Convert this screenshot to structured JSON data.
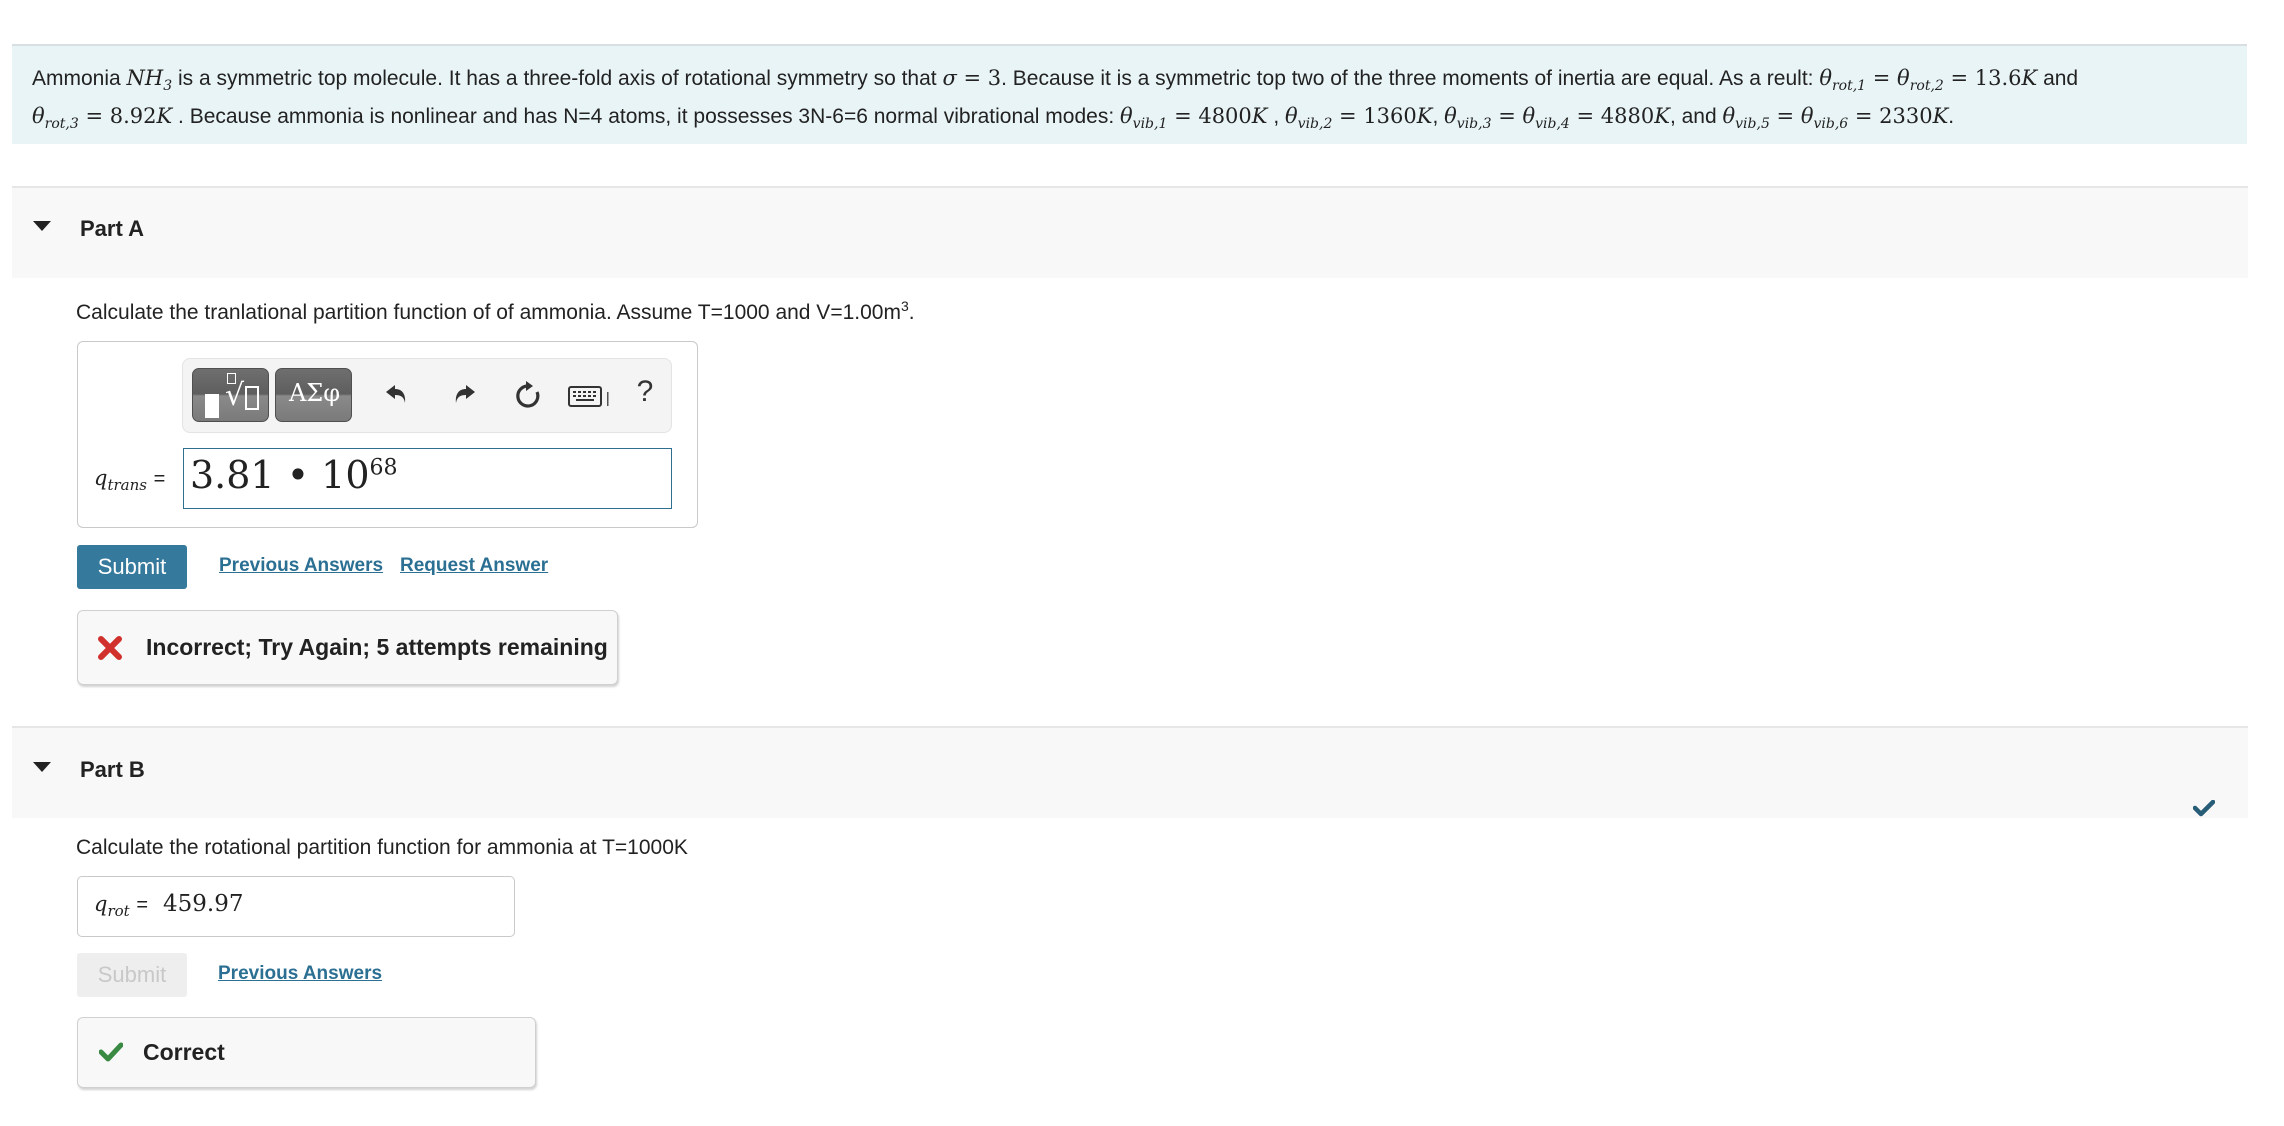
{
  "intro": {
    "line1": [
      {
        "t": "text",
        "v": "Ammonia "
      },
      {
        "t": "math",
        "v": "NH",
        "sub": "3"
      },
      {
        "t": "text",
        "v": " is a symmetric top molecule. It has a three-fold axis of rotational symmetry so that "
      },
      {
        "t": "math",
        "v": "σ"
      },
      {
        "t": "mathup",
        "v": " = 3"
      },
      {
        "t": "text",
        "v": ". Because it is a symmetric top two of the three moments of inertia are equal. As a reult: "
      },
      {
        "t": "math",
        "v": "θ",
        "sub": "rot,1"
      },
      {
        "t": "mathup",
        "v": " = "
      },
      {
        "t": "math",
        "v": "θ",
        "sub": "rot,2"
      },
      {
        "t": "mathup",
        "v": " = 13.6"
      },
      {
        "t": "math",
        "v": "K"
      },
      {
        "t": "text",
        "v": " and"
      }
    ],
    "line2": [
      {
        "t": "math",
        "v": "θ",
        "sub": "rot,3"
      },
      {
        "t": "mathup",
        "v": " = 8.92"
      },
      {
        "t": "math",
        "v": "K"
      },
      {
        "t": "text",
        "v": " . Because ammonia is nonlinear and has N=4 atoms, it possesses 3N-6=6 normal vibrational modes: "
      },
      {
        "t": "math",
        "v": "θ",
        "sub": "vib,1"
      },
      {
        "t": "mathup",
        "v": " = 4800"
      },
      {
        "t": "math",
        "v": "K"
      },
      {
        "t": "text",
        "v": " , "
      },
      {
        "t": "math",
        "v": "θ",
        "sub": "vib,2"
      },
      {
        "t": "mathup",
        "v": " = 1360"
      },
      {
        "t": "math",
        "v": "K"
      },
      {
        "t": "text",
        "v": ", "
      },
      {
        "t": "math",
        "v": "θ",
        "sub": "vib,3"
      },
      {
        "t": "mathup",
        "v": " = "
      },
      {
        "t": "math",
        "v": "θ",
        "sub": "vib,4"
      },
      {
        "t": "mathup",
        "v": " = 4880"
      },
      {
        "t": "math",
        "v": "K"
      },
      {
        "t": "text",
        "v": ", and "
      },
      {
        "t": "math",
        "v": "θ",
        "sub": "vib,5"
      },
      {
        "t": "mathup",
        "v": " = "
      },
      {
        "t": "math",
        "v": "θ",
        "sub": "vib,6"
      },
      {
        "t": "mathup",
        "v": " = 2330"
      },
      {
        "t": "math",
        "v": "K"
      },
      {
        "t": "text",
        "v": "."
      }
    ]
  },
  "partA": {
    "title": "Part A",
    "question": "Calculate the tranlational partition function of  of ammonia. Assume T=1000 and V=1.00m",
    "question_sup": "3",
    "question_end": ".",
    "toolbar": {
      "templates_icon": "templates-icon",
      "greek_label": "ΑΣφ",
      "undo_icon": "undo-icon",
      "redo_icon": "redo-icon",
      "reset_icon": "reset-icon",
      "keyboard_icon": "keyboard-icon",
      "help_label": "?"
    },
    "label_var": "q",
    "label_sub": "trans",
    "equals": "=",
    "answer_mantissa": "3.81 • 10",
    "answer_exponent": "68",
    "submit_label": "Submit",
    "previous_answers_label": "Previous Answers",
    "request_answer_label": "Request Answer",
    "feedback_text": "Incorrect; Try Again; 5 attempts remaining",
    "feedback_color": "#d0312d"
  },
  "partB": {
    "title": "Part B",
    "question": "Calculate the rotational partition function for ammonia at T=1000K",
    "label_var": "q",
    "label_sub": "rot",
    "equals": "=",
    "answer_value": "459.97",
    "submit_label": "Submit",
    "previous_answers_label": "Previous Answers",
    "feedback_text": "Correct",
    "feedback_color": "#3a8a44",
    "completed_color": "#285d78"
  }
}
